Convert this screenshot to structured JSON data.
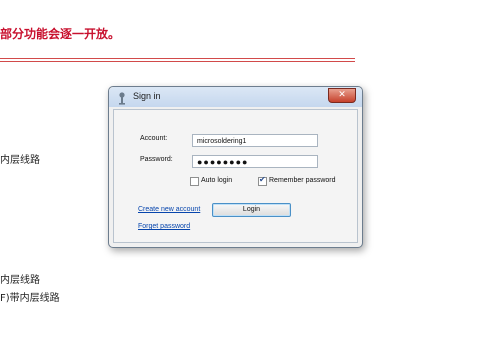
{
  "background": {
    "heading": "部分功能会逐一开放。",
    "lines": [
      "内层线路",
      "内层线路",
      "F)带内层线路"
    ]
  },
  "dialog": {
    "title": "Sign in",
    "close_label": "✕",
    "account_label": "Account:",
    "account_value": "microsoldering1",
    "password_label": "Password:",
    "password_value": "●●●●●●●●",
    "auto_login_label": "Auto login",
    "auto_login_checked": false,
    "remember_password_label": "Remember password",
    "remember_password_checked": true,
    "login_button": "Login",
    "create_account_link": "Create new account",
    "forget_password_link": "Forget password"
  },
  "colors": {
    "heading_red": "#c8102e",
    "link_blue": "#0645ad",
    "close_button_red": "#c6412c"
  }
}
